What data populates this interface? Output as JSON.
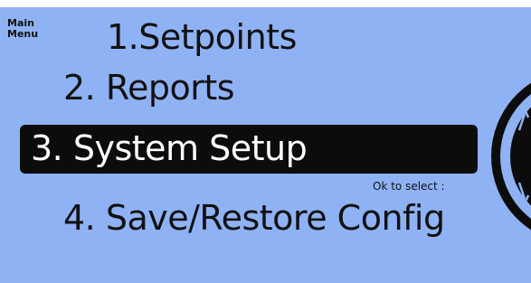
{
  "window": {
    "corner_label_line1": "Main",
    "corner_label_line2": "Menu"
  },
  "menu": {
    "items": [
      {
        "label": "1.Setpoints"
      },
      {
        "label": "2. Reports"
      },
      {
        "label": "3. System Setup"
      },
      {
        "label": "4. Save/Restore Config"
      }
    ],
    "selected_index": 2,
    "hint": "Ok to select :"
  },
  "icons": {
    "knob": "rotary-knob-icon"
  },
  "colors": {
    "screen_background": "#8fb2f4",
    "selection_background": "#0c0c0c",
    "selection_text": "#ffffff",
    "text": "#111111"
  }
}
